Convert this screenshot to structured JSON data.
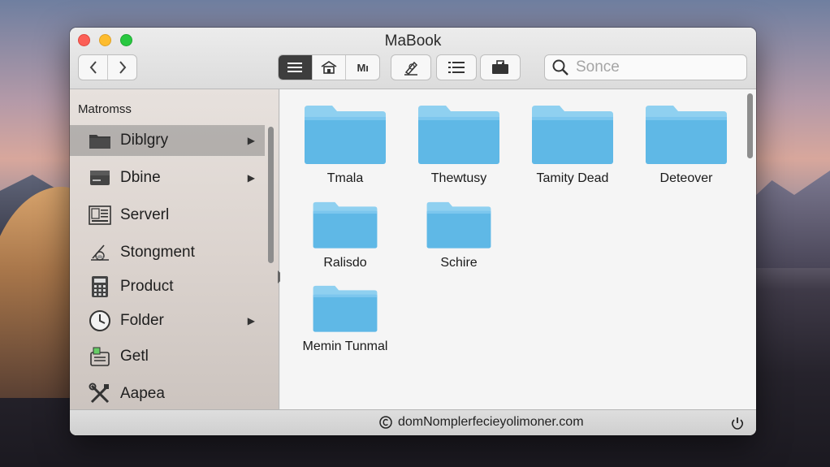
{
  "window": {
    "title": "MaBook"
  },
  "toolbar": {
    "nav_back": "‹",
    "nav_forward": "›",
    "view_buttons": [
      {
        "icon": "list-view-icon",
        "active": true
      },
      {
        "icon": "home-icon",
        "active": false
      },
      {
        "icon": "columns-view-icon",
        "label": "Mı",
        "active": false
      }
    ],
    "tool_buttons": [
      {
        "icon": "edit-icon"
      },
      {
        "icon": "text-list-icon"
      },
      {
        "icon": "briefcase-icon"
      }
    ]
  },
  "search": {
    "placeholder": "Sonce",
    "value": ""
  },
  "sidebar": {
    "header": "Matromss",
    "items": [
      {
        "label": "Diblgry",
        "icon": "folder-dark-icon",
        "chevron": true,
        "selected": true
      },
      {
        "label": "Dbine",
        "icon": "drive-icon",
        "chevron": true,
        "selected": false
      },
      {
        "label": "Serverl",
        "icon": "server-icon",
        "chevron": false,
        "selected": false
      },
      {
        "label": "Stongment",
        "icon": "storage-icon",
        "chevron": false,
        "selected": false
      },
      {
        "label": "Product",
        "icon": "calculator-icon",
        "chevron": false,
        "selected": false
      },
      {
        "label": "Folder",
        "icon": "clock-icon",
        "chevron": true,
        "selected": false
      },
      {
        "label": "Getl",
        "icon": "get-icon",
        "chevron": false,
        "selected": false
      },
      {
        "label": "Aapea",
        "icon": "tools-icon",
        "chevron": false,
        "selected": false
      }
    ]
  },
  "content": {
    "folders": [
      {
        "label": "Tmala"
      },
      {
        "label": "Thewtusy"
      },
      {
        "label": "Tamity Dead"
      },
      {
        "label": "Deteover"
      },
      {
        "label": "Ralisdo"
      },
      {
        "label": "Schire"
      },
      {
        "label": "Memin Tunmal"
      }
    ]
  },
  "statusbar": {
    "text": "domNomplerfecieyolimoner.com",
    "left_icon": "copyright-icon",
    "right_icon": "power-icon"
  },
  "colors": {
    "folder_top": "#8fd0f0",
    "folder_body": "#5fb8e6",
    "selected_bg": "#8a8a8a",
    "active_view": "#3d3d3d"
  }
}
